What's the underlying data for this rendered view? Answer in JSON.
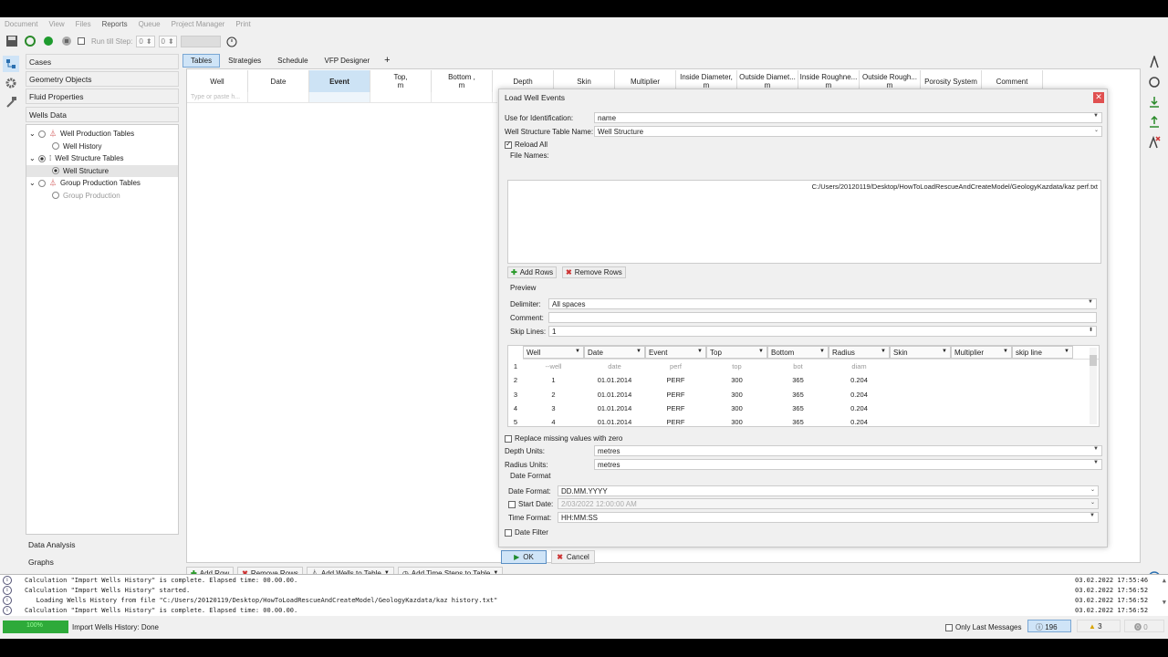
{
  "menu": [
    "Document",
    "View",
    "Files",
    "Reports",
    "Queue",
    "Project Manager",
    "Print"
  ],
  "toolbar": {
    "run_till_step": "Run till Step:",
    "spin1": "0",
    "spin2": "0"
  },
  "sidebar": {
    "cases": "Cases",
    "geometry": "Geometry Objects",
    "fluid": "Fluid Properties",
    "wells_data": "Wells Data",
    "tree": [
      "Well Production Tables",
      "Well History",
      "Well Structure Tables",
      "Well Structure",
      "Group Production Tables",
      "Group Production"
    ],
    "data_analysis": "Data Analysis",
    "graphs": "Graphs"
  },
  "tabs": [
    "Tables",
    "Strategies",
    "Schedule",
    "VFP Designer",
    "+"
  ],
  "columns": [
    "Well",
    "Date",
    "Event",
    "Top,\nm",
    "Bottom ,\nm",
    "Depth",
    "Skin",
    "Multiplier",
    "Inside Diameter,\nm",
    "Outside Diamet...\nm",
    "Inside Roughne...\nm",
    "Outside Rough...\nm",
    "Porosity System",
    "Comment"
  ],
  "table_placeholder": "Type or paste h...",
  "bottom_buttons": [
    "Add Row",
    "Remove Rows",
    "Add Wells to Table",
    "Add Time Steps to Table"
  ],
  "dialog": {
    "title": "Load Well Events",
    "use_for_id_label": "Use for Identification:",
    "use_for_id_value": "name",
    "table_name_label": "Well Structure Table Name:",
    "table_name_value": "Well Structure",
    "reload_all": "Reload All",
    "file_names": "File Names:",
    "file_path": "C:/Users/20120119/Desktop/HowToLoadRescueAndCreateModel/GeologyKazdata/kaz perf.txt",
    "add_rows": "Add Rows",
    "remove_rows": "Remove Rows",
    "preview": "Preview",
    "delimiter_label": "Delimiter:",
    "delimiter_value": "All spaces",
    "comment_label": "Comment:",
    "skip_lines_label": "Skip Lines:",
    "skip_lines_value": "1",
    "preview_cols": [
      "Well",
      "Date",
      "Event",
      "Top",
      "Bottom",
      "Radius",
      "Skin",
      "Multiplier",
      "skip line"
    ],
    "preview_rows": [
      [
        "1",
        "--well",
        "date",
        "perf",
        "top",
        "bot",
        "diam",
        "",
        ""
      ],
      [
        "2",
        "1",
        "01.01.2014",
        "PERF",
        "300",
        "365",
        "0.204",
        "",
        ""
      ],
      [
        "3",
        "2",
        "01.01.2014",
        "PERF",
        "300",
        "365",
        "0.204",
        "",
        ""
      ],
      [
        "4",
        "3",
        "01.01.2014",
        "PERF",
        "300",
        "365",
        "0.204",
        "",
        ""
      ],
      [
        "5",
        "4",
        "01.01.2014",
        "PERF",
        "300",
        "365",
        "0.204",
        "",
        ""
      ]
    ],
    "replace_missing": "Replace missing values with zero",
    "depth_units_label": "Depth Units:",
    "depth_units_value": "metres",
    "radius_units_label": "Radius Units:",
    "radius_units_value": "metres",
    "date_format_group": "Date Format",
    "date_format_label": "Date Format:",
    "date_format_value": "DD.MM.YYYY",
    "start_date_label": "Start Date:",
    "start_date_value": "2/03/2022 12:00:00 AM",
    "time_format_label": "Time Format:",
    "time_format_value": "HH:MM:SS",
    "date_filter": "Date Filter",
    "ok": "OK",
    "cancel": "Cancel"
  },
  "log": [
    {
      "text": "Calculation \"Import Wells History\" is complete. Elapsed time: 00.00.00.",
      "time": "03.02.2022 17:55:46"
    },
    {
      "text": "Calculation \"Import Wells History\" started.",
      "time": "03.02.2022 17:56:52"
    },
    {
      "text": "   Loading Wells History from file \"C:/Users/20120119/Desktop/HowToLoadRescueAndCreateModel/GeologyKazdata/kaz history.txt\"",
      "time": "03.02.2022 17:56:52"
    },
    {
      "text": "Calculation \"Import Wells History\" is complete. Elapsed time: 00.00.00.",
      "time": "03.02.2022 17:56:52"
    }
  ],
  "status": {
    "progress": "100%",
    "message": "Import Wells History: Done",
    "only_last": "Only Last Messages",
    "info_count": "196",
    "warn_count": "3",
    "err_count": "0"
  }
}
